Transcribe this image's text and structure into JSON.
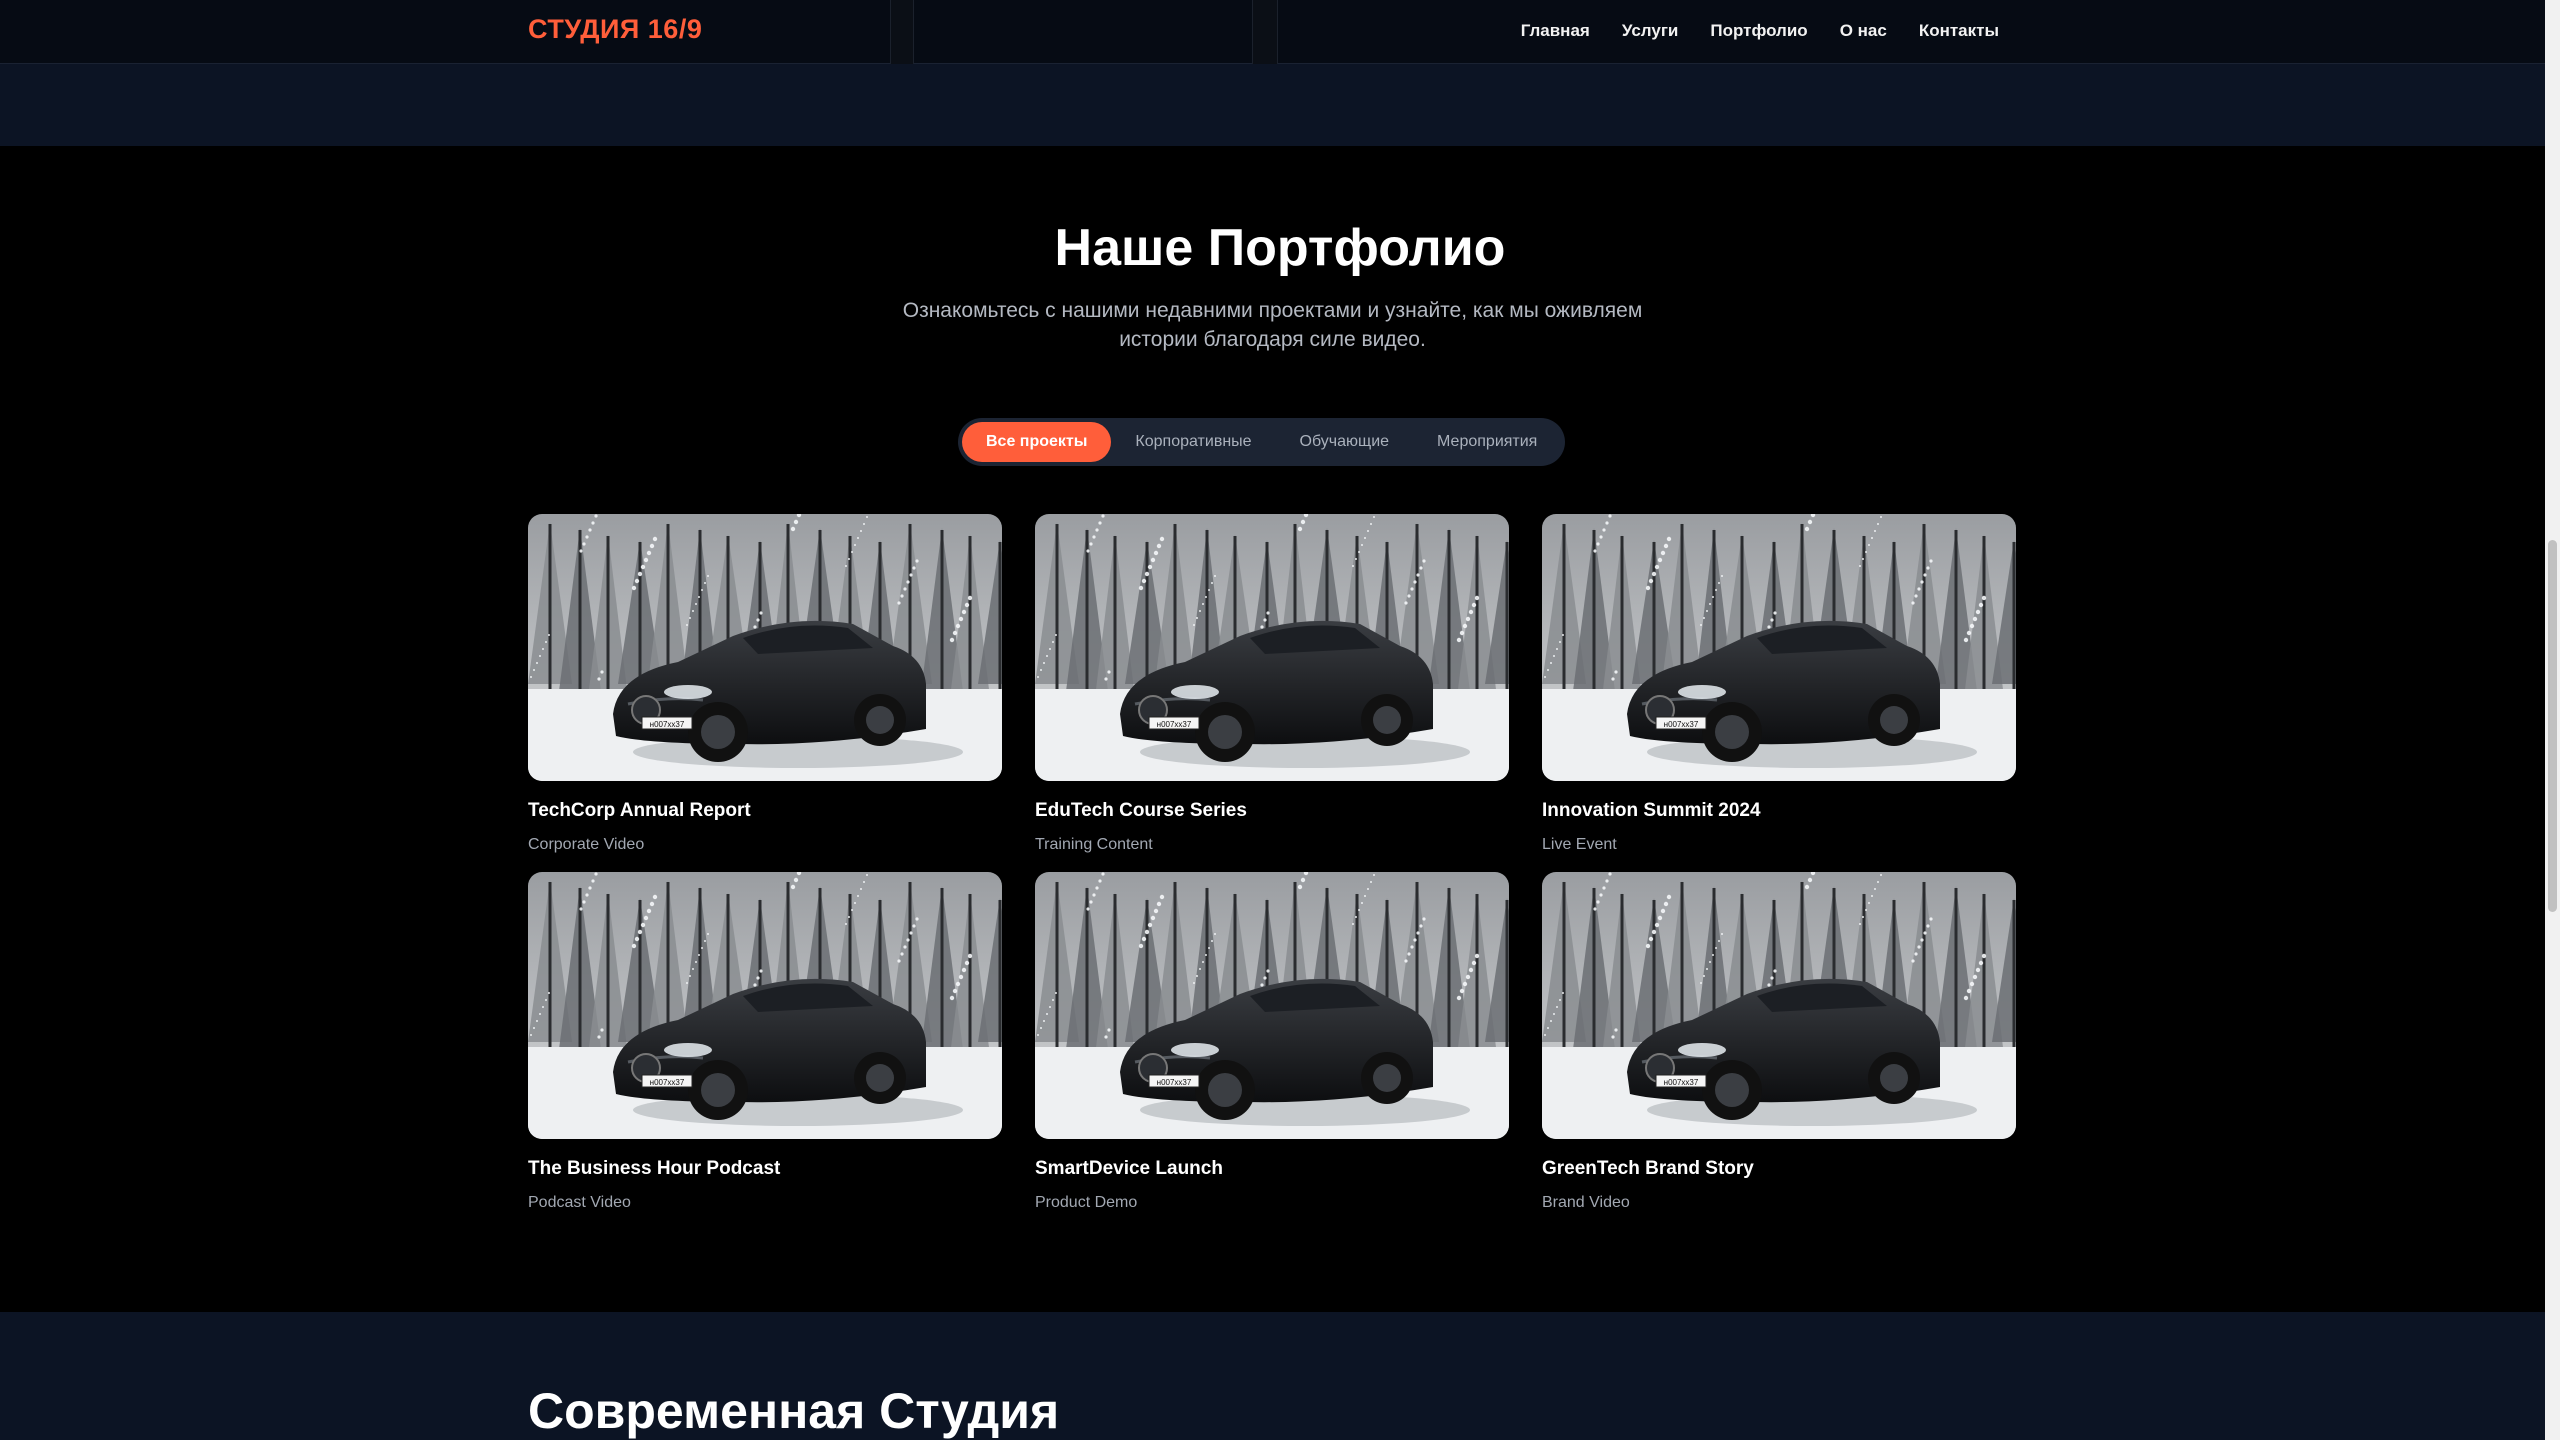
{
  "header": {
    "logo": "СТУДИЯ 16/9",
    "nav": [
      "Главная",
      "Услуги",
      "Портфолио",
      "О нас",
      "Контакты"
    ]
  },
  "portfolio": {
    "title": "Наше Портфолио",
    "subtitle": "Ознакомьтесь с нашими недавними проектами и узнайте, как мы оживляем истории благодаря силе видео.",
    "filters": [
      "Все проекты",
      "Корпоративные",
      "Обучающие",
      "Мероприятия"
    ],
    "active_filter": "Все проекты",
    "projects": [
      {
        "title": "TechCorp Annual Report",
        "category": "Corporate Video"
      },
      {
        "title": "EduTech Course Series",
        "category": "Training Content"
      },
      {
        "title": "Innovation Summit 2024",
        "category": "Live Event"
      },
      {
        "title": "The Business Hour Podcast",
        "category": "Podcast Video"
      },
      {
        "title": "SmartDevice Launch",
        "category": "Product Demo"
      },
      {
        "title": "GreenTech Brand Story",
        "category": "Brand Video"
      }
    ],
    "thumbnail_alt": "black-sports-car-in-snowy-forest",
    "plate_text": "н007хх37"
  },
  "next_section": {
    "title": "Современная Студия"
  },
  "colors": {
    "accent": "#ff5e3a",
    "nav_bg": "#060b14",
    "band_bg": "#0c1424",
    "section_bg": "#000000",
    "filter_bg": "#1c2433"
  }
}
